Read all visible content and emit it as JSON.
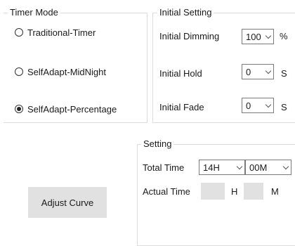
{
  "timer_mode": {
    "title": "Timer Mode",
    "options": [
      {
        "label": "Traditional-Timer",
        "selected": false
      },
      {
        "label": "SelfAdapt-MidNight",
        "selected": false
      },
      {
        "label": "SelfAdapt-Percentage",
        "selected": true
      }
    ]
  },
  "initial_setting": {
    "title": "Initial Setting",
    "dimming": {
      "label": "Initial Dimming",
      "value": "100",
      "unit": "%"
    },
    "hold": {
      "label": "Initial Hold",
      "value": "0",
      "unit": "S"
    },
    "fade": {
      "label": "Initial Fade",
      "value": "0",
      "unit": "S"
    }
  },
  "setting": {
    "title": "Setting",
    "total_time": {
      "label": "Total Time",
      "hours": "14H",
      "minutes": "00M"
    },
    "actual_time": {
      "label": "Actual Time",
      "hours_value": "",
      "hours_unit": "H",
      "minutes_value": "",
      "minutes_unit": "M"
    }
  },
  "adjust_curve_button": "Adjust Curve"
}
